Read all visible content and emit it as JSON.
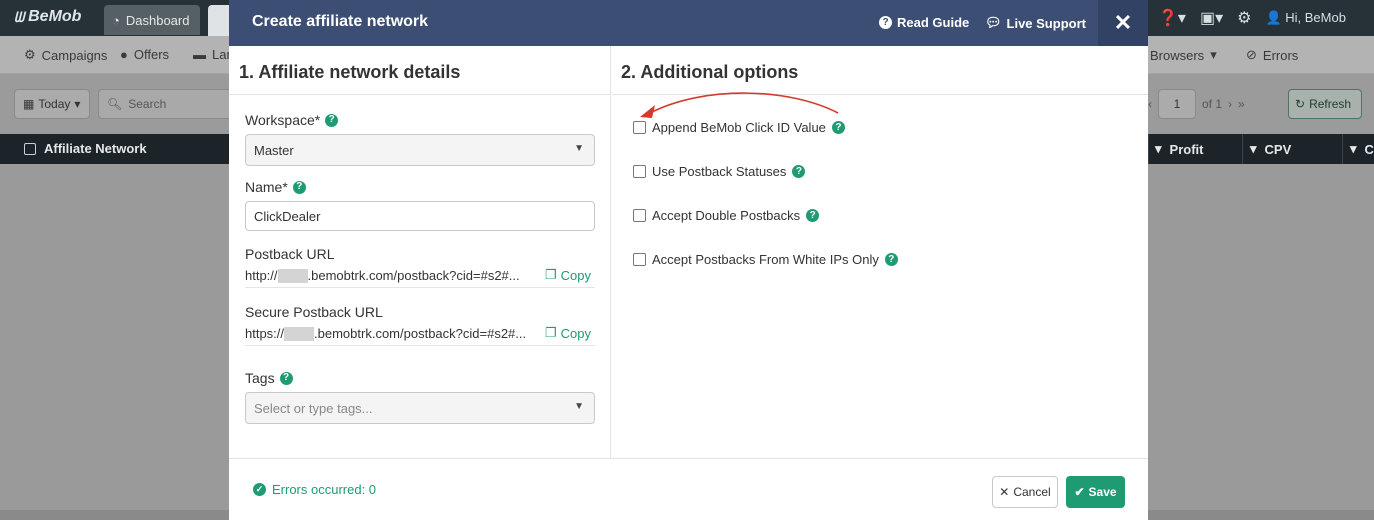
{
  "app": {
    "logo": "BeMob",
    "dashboard_tab": "Dashboard",
    "user_greeting": "Hi, BeMob",
    "nav": {
      "campaigns": "Campaigns",
      "offers": "Offers",
      "landers": "Lan",
      "browsers": "Browsers",
      "errors": "Errors"
    },
    "toolbar": {
      "date_range": "Today",
      "search_placeholder": "Search",
      "page_number": "1",
      "page_total": "of 1",
      "refresh": "Refresh"
    },
    "table": {
      "columns": [
        "Affiliate Network",
        "Profit",
        "CPV",
        "C"
      ]
    }
  },
  "modal": {
    "title": "Create affiliate network",
    "read_guide": "Read Guide",
    "live_support": "Live Support",
    "left": {
      "section_title": "1. Affiliate network details",
      "workspace_label": "Workspace*",
      "workspace_value": "Master",
      "name_label": "Name*",
      "name_value": "ClickDealer",
      "postback_label": "Postback URL",
      "postback_prefix": "http://",
      "postback_suffix": ".bemobtrk.com/postback?cid=#s2#...",
      "secure_postback_label": "Secure Postback URL",
      "secure_postback_prefix": "https://",
      "secure_postback_suffix": ".bemobtrk.com/postback?cid=#s2#...",
      "copy_label": "Copy",
      "tags_label": "Tags",
      "tags_placeholder": "Select or type tags..."
    },
    "right": {
      "section_title": "2. Additional options",
      "options": [
        "Append BeMob Click ID Value",
        "Use Postback Statuses",
        "Accept Double Postbacks",
        "Accept Postbacks From White IPs Only"
      ]
    },
    "footer": {
      "errors_text": "Errors occurred: 0",
      "cancel": "Cancel",
      "save": "Save"
    }
  },
  "colors": {
    "header": "#3c4e73",
    "accent_green": "#1e9b72",
    "annotation_arrow": "#d63a2f"
  },
  "icons": [
    "bemob-logo-icon",
    "dashboard-icon",
    "home-icon",
    "help-icon",
    "copy-icon",
    "comments-icon",
    "close-icon",
    "calendar-icon",
    "search-icon",
    "refresh-icon",
    "filter-icon",
    "check-circle-icon",
    "check-icon",
    "times-icon",
    "chevron-down-icon"
  ]
}
